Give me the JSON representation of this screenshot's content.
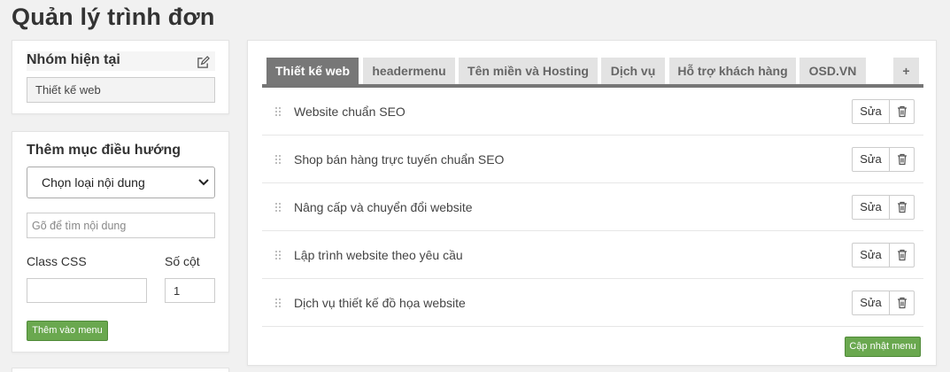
{
  "page": {
    "title": "Quản lý trình đơn"
  },
  "group_panel": {
    "title": "Nhóm hiện tại",
    "edit_icon": "edit-icon",
    "current_value": "Thiết kế web"
  },
  "add_panel": {
    "title": "Thêm mục điều hướng",
    "content_type_select": "Chọn loại nội dung",
    "search_placeholder": "Gõ để tìm nội dung",
    "class_css_label": "Class CSS",
    "class_css_value": "",
    "columns_label": "Số cột",
    "columns_value": "1",
    "add_button": "Thêm vào menu"
  },
  "menu_panel": {
    "tabs": [
      {
        "label": "Thiết kế web",
        "active": true
      },
      {
        "label": "headermenu",
        "active": false
      },
      {
        "label": "Tên miền và Hosting",
        "active": false
      },
      {
        "label": "Dịch vụ",
        "active": false
      },
      {
        "label": "Hỗ trợ khách hàng",
        "active": false
      },
      {
        "label": "OSD.VN",
        "active": false
      },
      {
        "label": "+",
        "active": false
      }
    ],
    "items": [
      {
        "label": "Website chuẩn SEO",
        "edit_label": "Sửa"
      },
      {
        "label": "Shop bán hàng trực tuyến chuẩn SEO",
        "edit_label": "Sửa"
      },
      {
        "label": "Nâng cấp và chuyển đổi website",
        "edit_label": "Sửa"
      },
      {
        "label": "Lập trình website theo yêu cầu",
        "edit_label": "Sửa"
      },
      {
        "label": "Dịch vụ thiết kế đồ họa website",
        "edit_label": "Sửa"
      }
    ],
    "save_button": "Cập nhật menu"
  },
  "colors": {
    "accent_green": "#6aa84f",
    "active_tab": "#777777",
    "inactive_tab": "#e3e3e3"
  }
}
